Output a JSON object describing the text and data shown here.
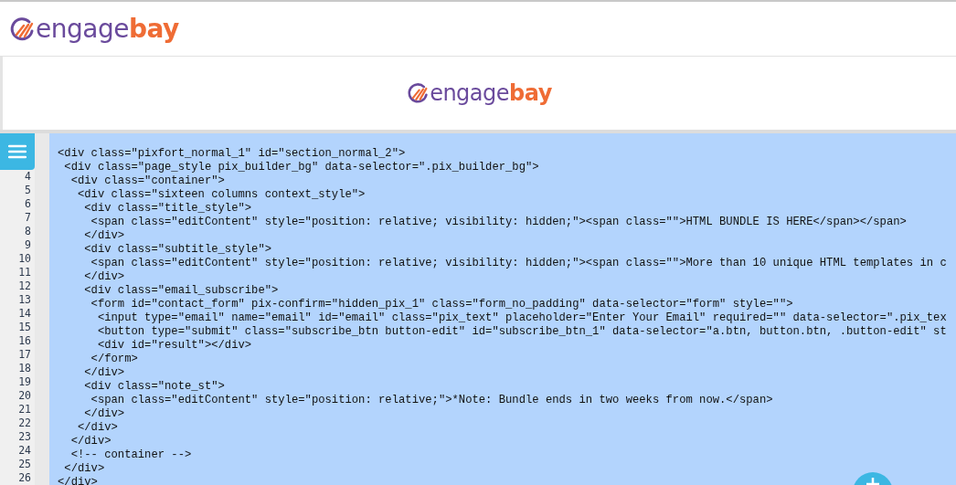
{
  "header": {
    "logo": "engage**bay**"
  },
  "banner": {
    "logo": "engage**bay**"
  },
  "editor": {
    "lines": [
      {
        "code": "<div class=\"pixfort_normal_1\" id=\"section_normal_2\">"
      },
      {
        "code": " <div class=\"page_style pix_builder_bg\" data-selector=\".pix_builder_bg\">"
      },
      {
        "number": "4",
        "code": "  <div class=\"container\">"
      },
      {
        "number": "5",
        "code": "   <div class=\"sixteen columns context_style\">"
      },
      {
        "number": "6",
        "code": "    <div class=\"title_style\">"
      },
      {
        "number": "7",
        "code": "     <span class=\"editContent\" style=\"position: relative; visibility: hidden;\"><span class=\"\">HTML BUNDLE IS HERE</span></span>"
      },
      {
        "number": "8",
        "code": "    </div>"
      },
      {
        "number": "9",
        "code": "    <div class=\"subtitle_style\">"
      },
      {
        "number": "10",
        "code": "     <span class=\"editContent\" style=\"position: relative; visibility: hidden;\"><span class=\"\">More than 10 unique HTML templates in c"
      },
      {
        "number": "11",
        "code": "    </div>"
      },
      {
        "number": "12",
        "code": "    <div class=\"email_subscribe\">"
      },
      {
        "number": "13",
        "code": "     <form id=\"contact_form\" pix-confirm=\"hidden_pix_1\" class=\"form_no_padding\" data-selector=\"form\" style=\"\">"
      },
      {
        "number": "14",
        "code": "      <input type=\"email\" name=\"email\" id=\"email\" class=\"pix_text\" placeholder=\"Enter Your Email\" required=\"\" data-selector=\".pix_tex"
      },
      {
        "number": "15",
        "code": "      <button type=\"submit\" class=\"subscribe_btn button-edit\" id=\"subscribe_btn_1\" data-selector=\"a.btn, button.btn, .button-edit\" st"
      },
      {
        "number": "16",
        "code": "      <div id=\"result\"></div>"
      },
      {
        "number": "17",
        "code": "     </form>"
      },
      {
        "number": "18",
        "code": "    </div>"
      },
      {
        "number": "19",
        "code": "    <div class=\"note_st\">"
      },
      {
        "number": "20",
        "code": "     <span class=\"editContent\" style=\"position: relative;\">*Note: Bundle ends in two weeks from now.</span>"
      },
      {
        "number": "21",
        "code": "    </div>"
      },
      {
        "number": "22",
        "code": "   </div>"
      },
      {
        "number": "23",
        "code": "  </div>"
      },
      {
        "number": "24",
        "code": "  <!-- container -->"
      },
      {
        "number": "25",
        "code": " </div>"
      },
      {
        "number": "26",
        "code": "</div>"
      }
    ]
  }
}
